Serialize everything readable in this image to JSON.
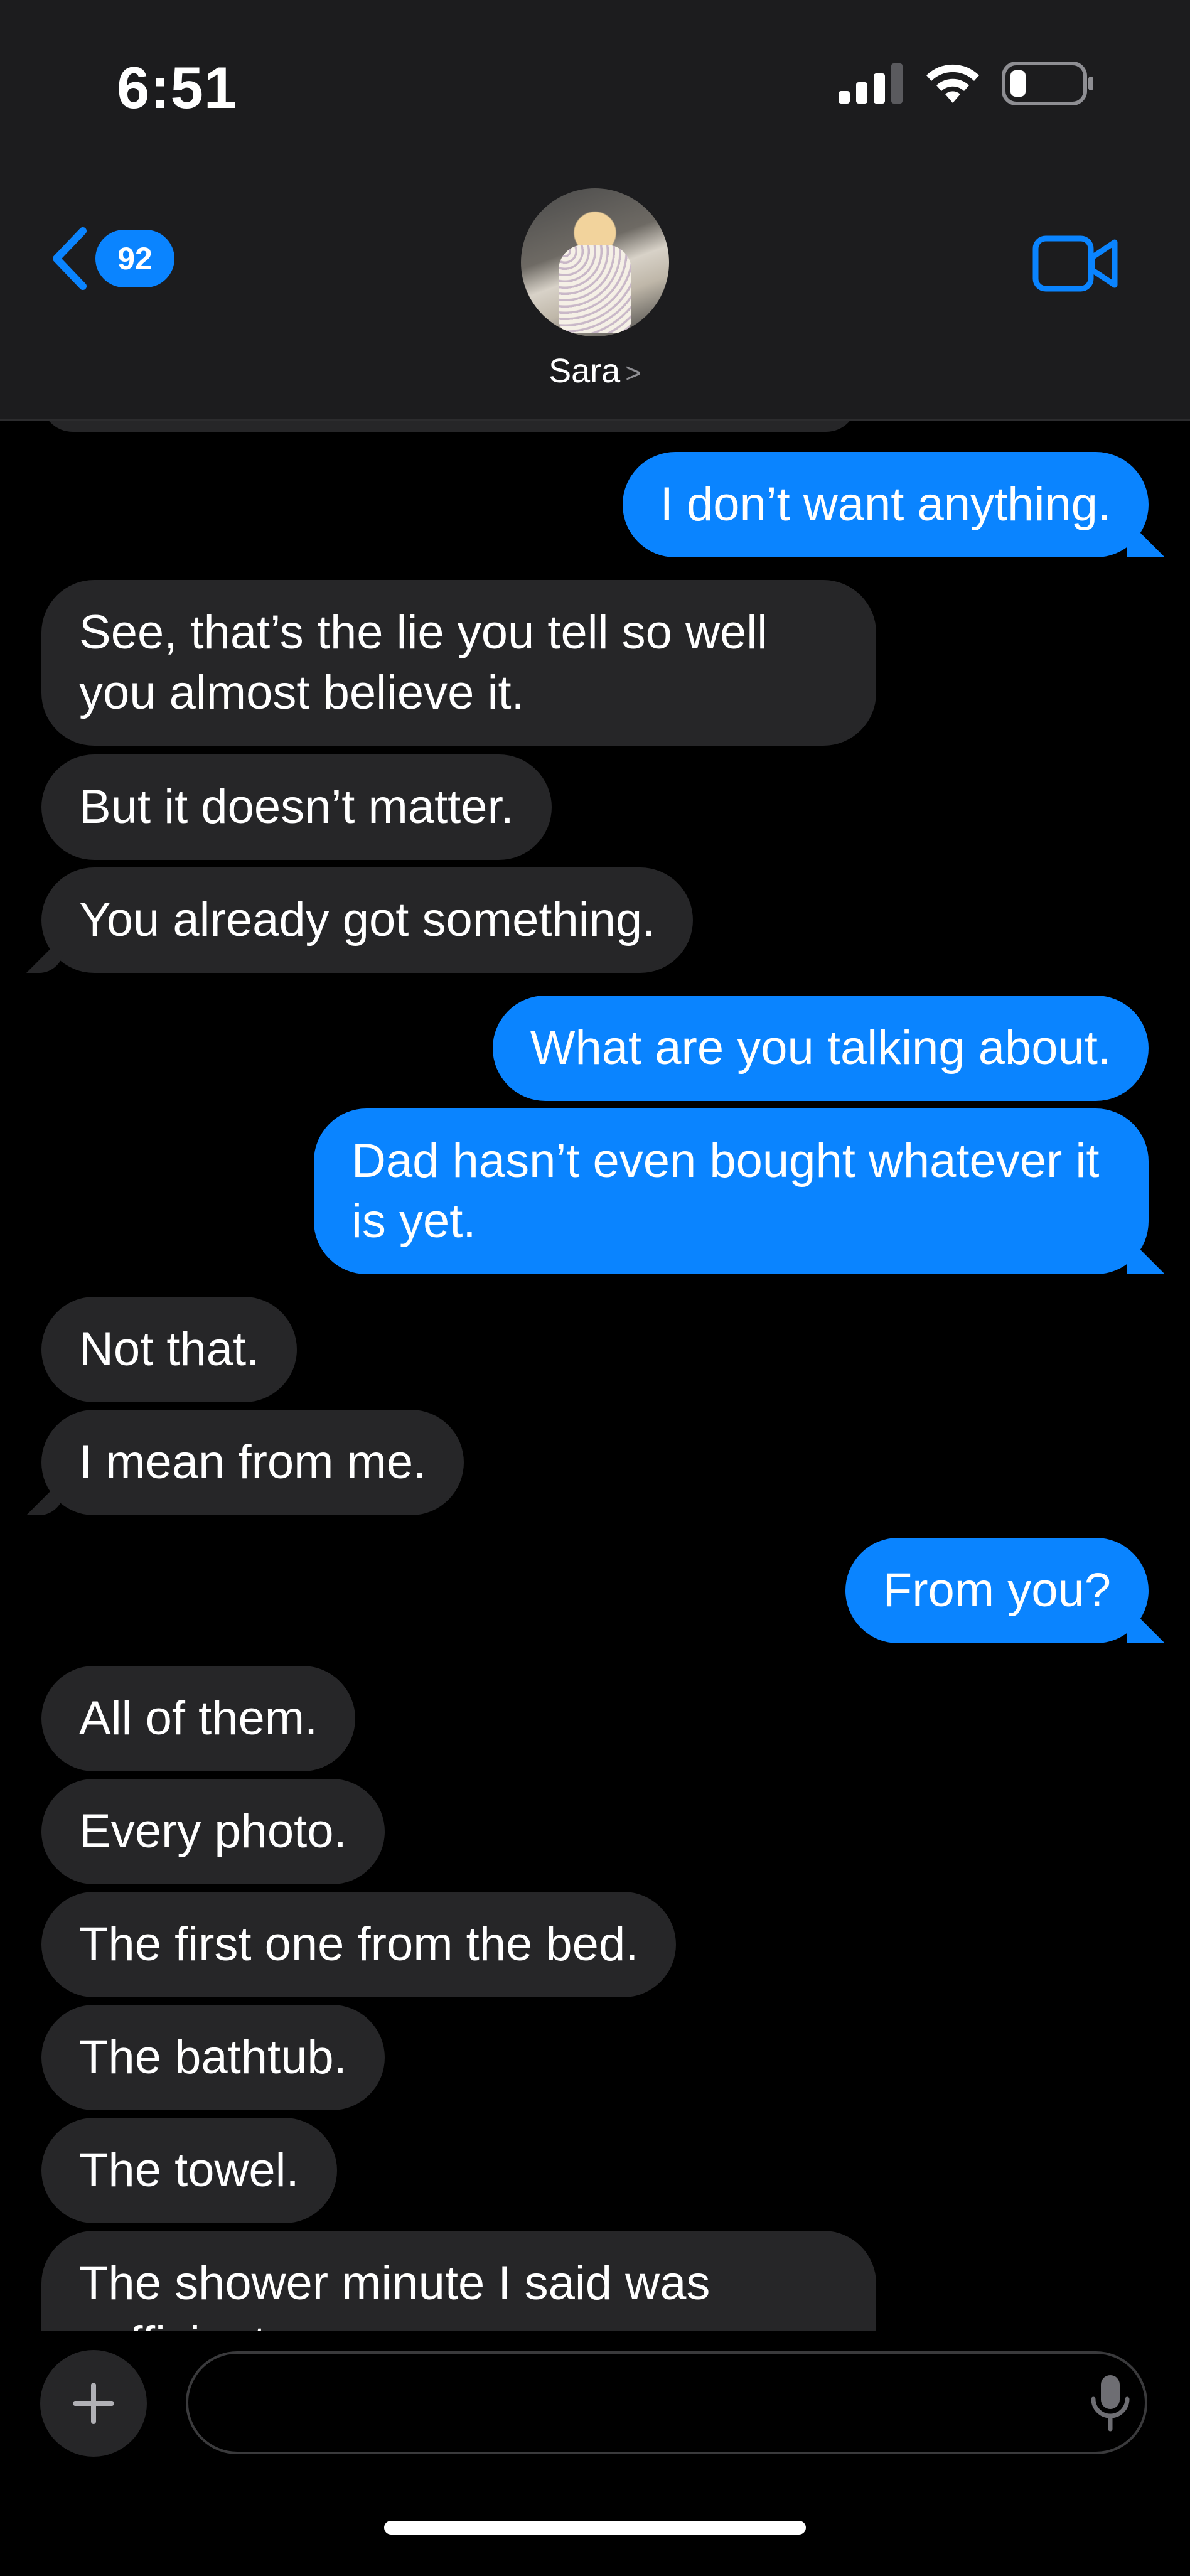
{
  "status_bar": {
    "time": "6:51"
  },
  "header": {
    "back_count": "92",
    "contact_name": "Sara",
    "name_chevron": ">"
  },
  "messages": [
    {
      "from": "other",
      "text": ""
    },
    {
      "from": "me",
      "text": "I don’t want anything."
    },
    {
      "from": "other",
      "text": "See, that’s the lie you tell so well you almost believe it."
    },
    {
      "from": "other",
      "text": "But it doesn’t matter."
    },
    {
      "from": "other",
      "text": "You already got something."
    },
    {
      "from": "me",
      "text": "What are you talking about."
    },
    {
      "from": "me",
      "text": "Dad hasn’t even bought whatever it is yet."
    },
    {
      "from": "other",
      "text": "Not that."
    },
    {
      "from": "other",
      "text": "I mean from me."
    },
    {
      "from": "me",
      "text": "From you?"
    },
    {
      "from": "other",
      "text": "All of them."
    },
    {
      "from": "other",
      "text": "Every photo."
    },
    {
      "from": "other",
      "text": "The first one from the bed."
    },
    {
      "from": "other",
      "text": "The bathtub."
    },
    {
      "from": "other",
      "text": "The towel."
    },
    {
      "from": "other",
      "text": "The shower minute I said was sufficient."
    }
  ],
  "input": {
    "placeholder": ""
  },
  "colors": {
    "accent": "#0a84ff",
    "incoming_bubble": "#262628",
    "header_bg": "#1c1c1e"
  }
}
